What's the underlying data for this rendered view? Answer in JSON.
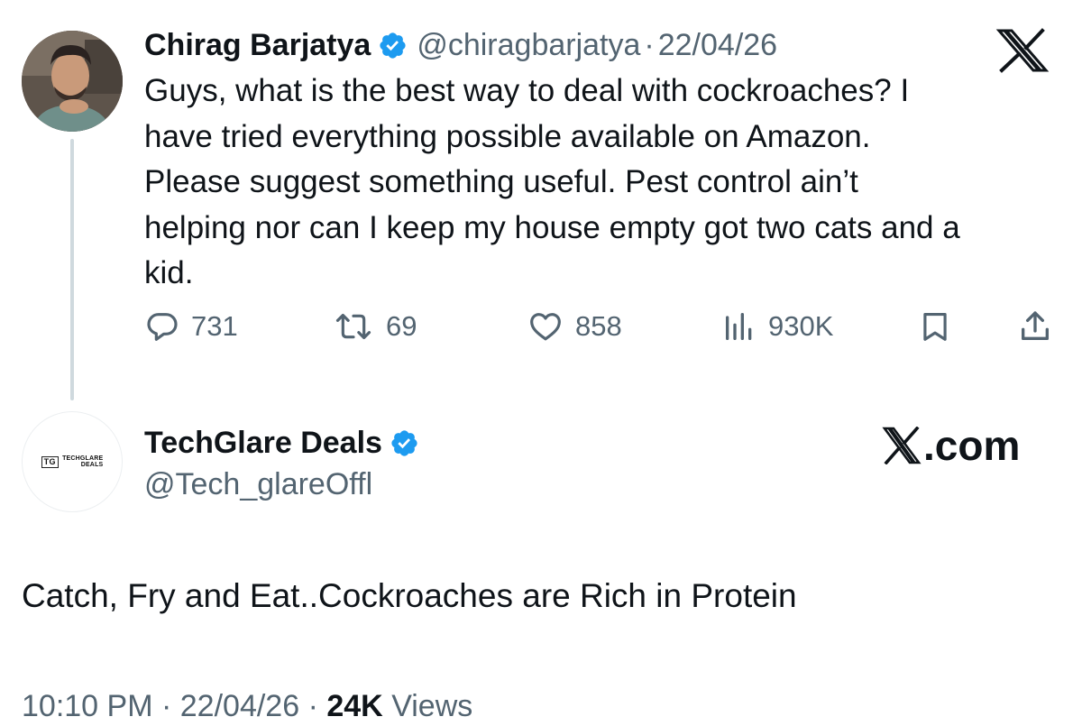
{
  "colors": {
    "text_primary": "#0f1419",
    "text_secondary": "#536471",
    "verified_blue": "#1d9bf0",
    "thread_line": "#cfd9de"
  },
  "parent_tweet": {
    "author_name": "Chirag Barjatya",
    "handle": "@chiragbarjatya",
    "separator": "·",
    "date": "22/04/26",
    "text": "Guys, what is the best way to deal with cockroaches? I\nhave tried everything possible available on Amazon.\nPlease suggest something useful. Pest control ain’t\nhelping nor can I keep my house empty got two cats and a\nkid.",
    "platform_icon": "x-logo-icon",
    "actions": {
      "replies": "731",
      "reposts": "69",
      "likes": "858",
      "views": "930K"
    }
  },
  "reply_tweet": {
    "author_name": "TechGlare Deals",
    "handle": "@Tech_glareOffl",
    "avatar_logo": {
      "badge": "TG",
      "line1": "TECHGLARE",
      "line2": "DEALS"
    },
    "watermark": ".com",
    "text": "Catch, Fry and Eat..Cockroaches are Rich in Protein",
    "time": "10:10 PM",
    "separator": "·",
    "date": "22/04/26",
    "views_count": "24K",
    "views_label": "Views"
  }
}
